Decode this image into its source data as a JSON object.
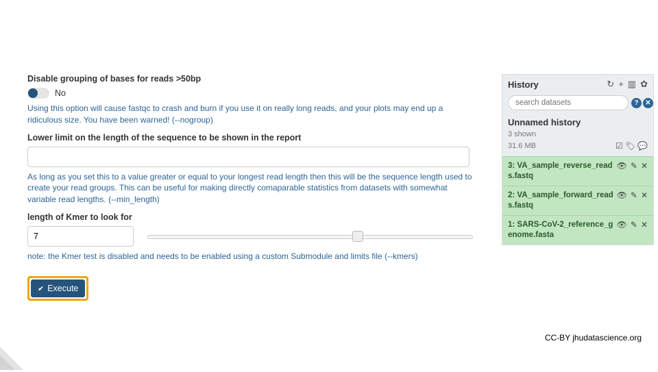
{
  "form": {
    "disable_grouping": {
      "label": "Disable grouping of bases for reads >50bp",
      "value": "No",
      "help": "Using this option will cause fastqc to crash and burn if you use it on really long reads, and your plots may end up a ridiculous size. You have been warned! (--nogroup)"
    },
    "lower_limit": {
      "label": "Lower limit on the length of the sequence to be shown in the report",
      "value": "",
      "help": "As long as you set this to a value greater or equal to your longest read length then this will be the sequence length used to create your read groups. This can be useful for making directly comaparable statistics from datasets with somewhat variable read lengths. (--min_length)"
    },
    "kmer": {
      "label": "length of Kmer to look for",
      "value": "7",
      "help": "note: the Kmer test is disabled and needs to be enabled using a custom Submodule and limits file (--kmers)"
    },
    "execute_label": "Execute"
  },
  "history": {
    "title": "History",
    "search_placeholder": "search datasets",
    "name": "Unnamed history",
    "shown": "3 shown",
    "size": "31.6 MB",
    "datasets": [
      {
        "title": "3: VA_sample_reverse_reads.fastq"
      },
      {
        "title": "2: VA_sample_forward_reads.fastq"
      },
      {
        "title": "1: SARS-CoV-2_reference_genome.fasta"
      }
    ]
  },
  "attribution": "CC-BY  jhudatascience.org"
}
